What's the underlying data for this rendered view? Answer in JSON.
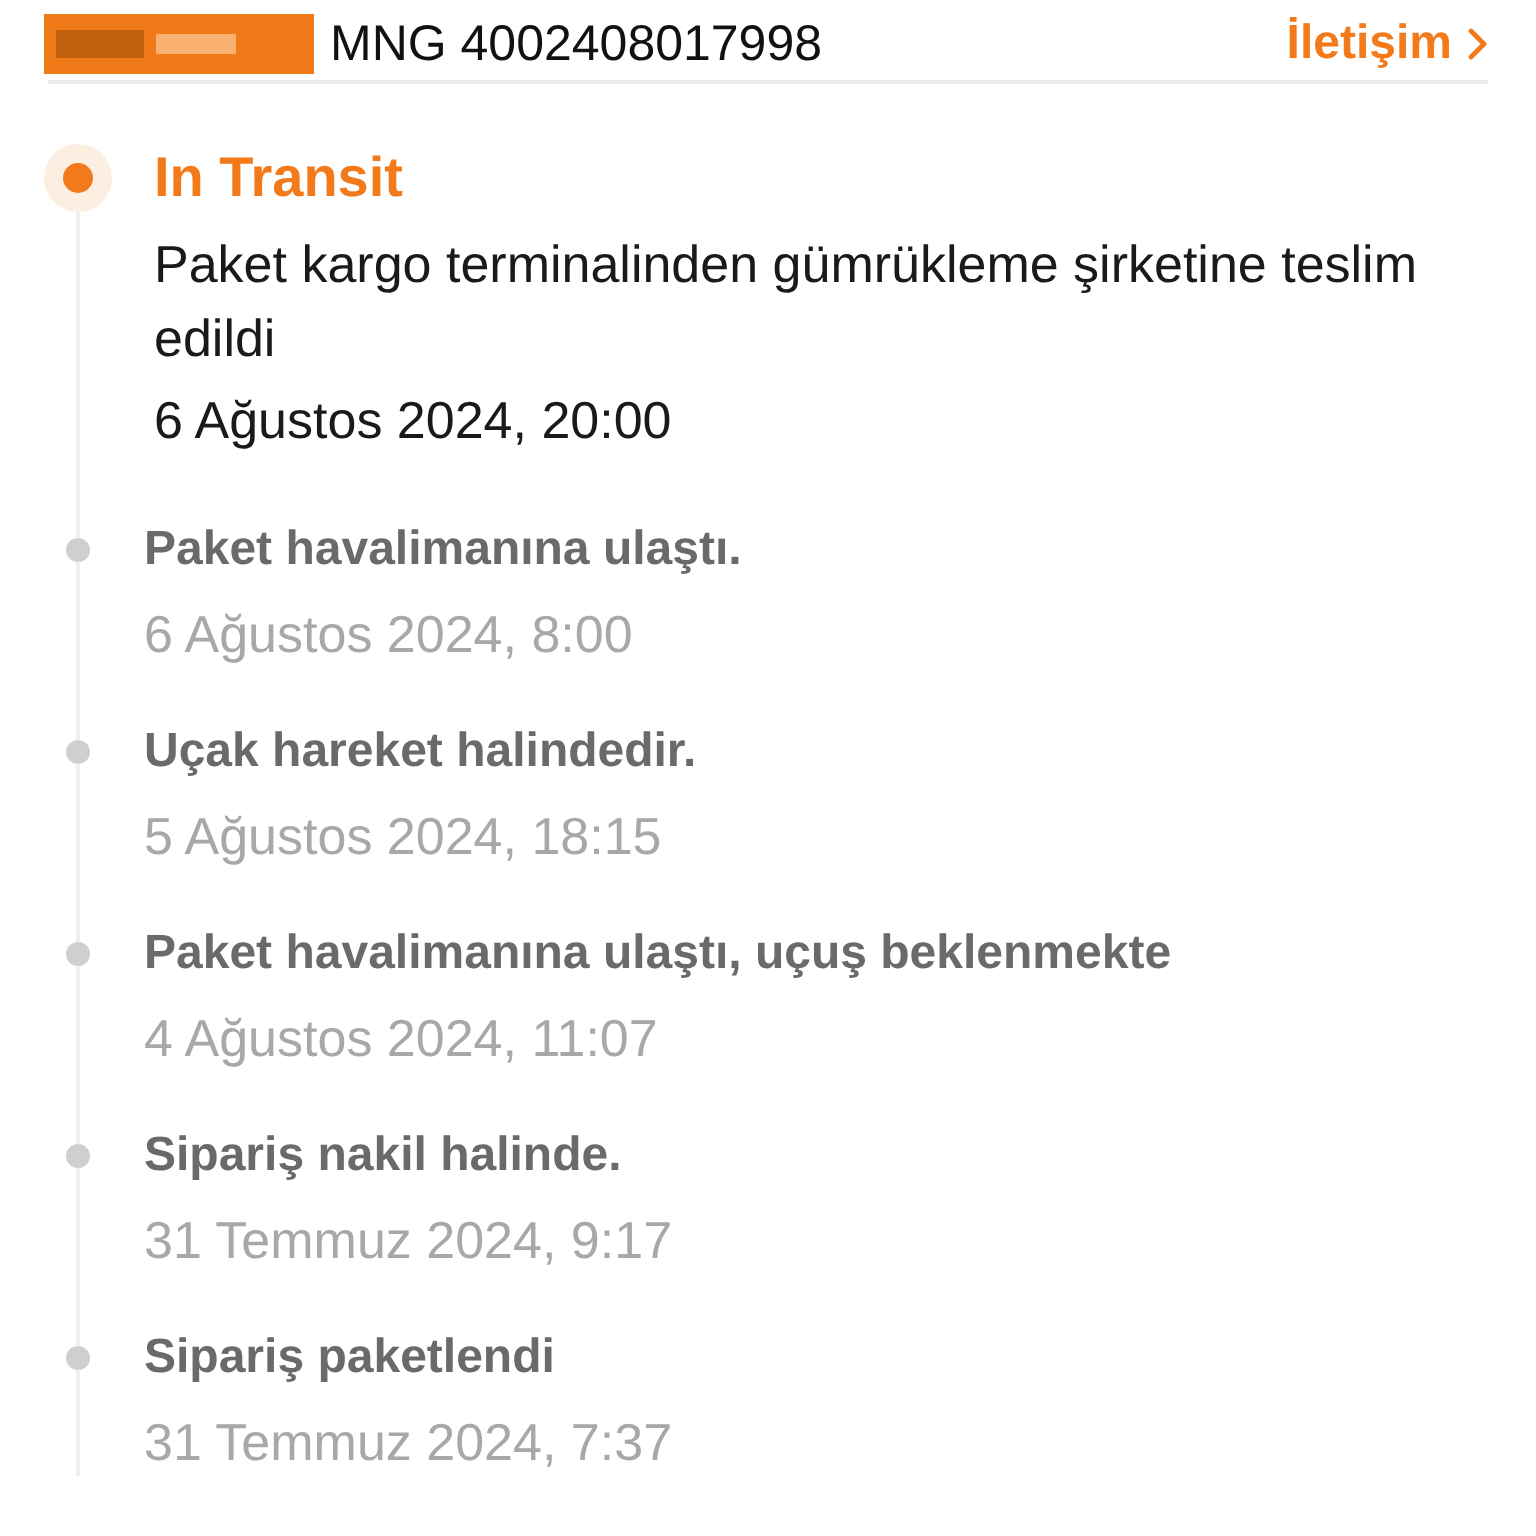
{
  "header": {
    "tracking_number": "MNG 4002408017998",
    "contact_link": "İletişim"
  },
  "timeline": [
    {
      "current": true,
      "title": "In Transit",
      "detail": "Paket kargo terminalinden gümrükleme şirketine teslim edildi",
      "date": "6 Ağustos 2024, 20:00"
    },
    {
      "current": false,
      "title": "Paket havalimanına ulaştı.",
      "date": "6 Ağustos 2024, 8:00"
    },
    {
      "current": false,
      "title": "Uçak hareket halindedir.",
      "date": "5 Ağustos 2024, 18:15"
    },
    {
      "current": false,
      "title": "Paket havalimanına ulaştı, uçuş beklenmekte",
      "date": "4 Ağustos 2024, 11:07"
    },
    {
      "current": false,
      "title": "Sipariş nakil halinde.",
      "date": "31 Temmuz 2024, 9:17"
    },
    {
      "current": false,
      "title": "Sipariş paketlendi",
      "date": "31 Temmuz 2024, 7:37"
    }
  ]
}
